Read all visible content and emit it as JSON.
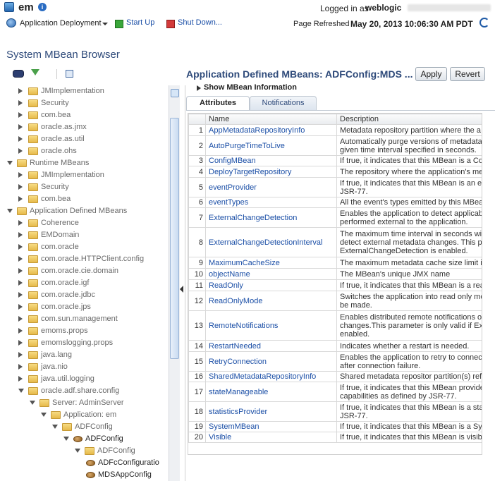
{
  "header": {
    "app_name": "em",
    "logged_in_label": "Logged in as",
    "user": "weblogic",
    "nav_menu": "Application Deployment",
    "start_up": "Start Up",
    "shut_down": "Shut Down...",
    "refresh_label": "Page Refreshed",
    "refresh_time": "May 20, 2013 10:06:30 AM PDT"
  },
  "sidebar": {
    "title": "System MBean Browser",
    "tree": [
      {
        "label": "JMImplementation",
        "icon": "folder",
        "expander": "collapsed"
      },
      {
        "label": "Security",
        "icon": "folder",
        "expander": "collapsed"
      },
      {
        "label": "com.bea",
        "icon": "folder",
        "expander": "collapsed"
      },
      {
        "label": "oracle.as.jmx",
        "icon": "folder",
        "expander": "collapsed"
      },
      {
        "label": "oracle.as.util",
        "icon": "folder",
        "expander": "collapsed"
      },
      {
        "label": "oracle.ohs",
        "icon": "folder",
        "expander": "collapsed"
      },
      {
        "label": "Runtime MBeans",
        "icon": "folder",
        "expander": "expanded"
      },
      {
        "label": "JMImplementation",
        "icon": "folder",
        "expander": "collapsed"
      },
      {
        "label": "Security",
        "icon": "folder",
        "expander": "collapsed"
      },
      {
        "label": "com.bea",
        "icon": "folder",
        "expander": "collapsed"
      },
      {
        "label": "Application Defined MBeans",
        "icon": "folder",
        "expander": "expanded"
      },
      {
        "label": "Coherence",
        "icon": "folder",
        "expander": "collapsed"
      },
      {
        "label": "EMDomain",
        "icon": "folder",
        "expander": "collapsed"
      },
      {
        "label": "com.oracle",
        "icon": "folder",
        "expander": "collapsed"
      },
      {
        "label": "com.oracle.HTTPClient.config",
        "icon": "folder",
        "expander": "collapsed"
      },
      {
        "label": "com.oracle.cie.domain",
        "icon": "folder",
        "expander": "collapsed"
      },
      {
        "label": "com.oracle.igf",
        "icon": "folder",
        "expander": "collapsed"
      },
      {
        "label": "com.oracle.jdbc",
        "icon": "folder",
        "expander": "collapsed"
      },
      {
        "label": "com.oracle.jps",
        "icon": "folder",
        "expander": "collapsed"
      },
      {
        "label": "com.sun.management",
        "icon": "folder",
        "expander": "collapsed"
      },
      {
        "label": "emoms.props",
        "icon": "folder",
        "expander": "collapsed"
      },
      {
        "label": "emomslogging.props",
        "icon": "folder",
        "expander": "collapsed"
      },
      {
        "label": "java.lang",
        "icon": "folder",
        "expander": "collapsed"
      },
      {
        "label": "java.nio",
        "icon": "folder",
        "expander": "collapsed"
      },
      {
        "label": "java.util.logging",
        "icon": "folder",
        "expander": "collapsed"
      },
      {
        "label": "oracle.adf.share.config",
        "icon": "folder",
        "expander": "expanded"
      },
      {
        "label": "Server: AdminServer",
        "icon": "folder",
        "expander": "expanded"
      },
      {
        "label": "Application: em",
        "icon": "folder",
        "expander": "expanded"
      },
      {
        "label": "ADFConfig",
        "icon": "folder",
        "expander": "expanded"
      },
      {
        "label": "ADFConfig",
        "icon": "bean",
        "expander": "expanded"
      },
      {
        "label": "ADFConfig",
        "icon": "folder",
        "expander": "expanded"
      },
      {
        "label": "ADFcConfiguratio",
        "icon": "bean",
        "expander": "none"
      },
      {
        "label": "MDSAppConfig",
        "icon": "bean",
        "expander": "none"
      }
    ]
  },
  "main": {
    "title": "Application Defined MBeans: ADFConfig:MDS ...",
    "apply": "Apply",
    "revert": "Revert",
    "show_info": "Show MBean Information",
    "tabs": [
      "Attributes",
      "Notifications"
    ],
    "columns": [
      "Name",
      "Description"
    ],
    "rows": [
      {
        "n": "1",
        "name": "AppMetadataRepositoryInfo",
        "desc": "Metadata repository partition where the a"
      },
      {
        "n": "2",
        "name": "AutoPurgeTimeToLive",
        "desc": "Automatically purge versions of metadata given time interval specified in seconds."
      },
      {
        "n": "3",
        "name": "ConfigMBean",
        "desc": "If true, it indicates that this MBean is a Co"
      },
      {
        "n": "4",
        "name": "DeployTargetRepository",
        "desc": "The repository where the application's met"
      },
      {
        "n": "5",
        "name": "eventProvider",
        "desc": "If true, it indicates that this MBean is an e JSR-77."
      },
      {
        "n": "6",
        "name": "eventTypes",
        "desc": "All the event's types emitted by this MBea"
      },
      {
        "n": "7",
        "name": "ExternalChangeDetection",
        "desc": "Enables the application to detect applicabl performed external to the application."
      },
      {
        "n": "8",
        "name": "ExternalChangeDetectionInterval",
        "desc": "The maximum time interval in seconds with detect external metadata changes. This p ExternalChangeDetection is enabled."
      },
      {
        "n": "9",
        "name": "MaximumCacheSize",
        "desc": "The maximum metadata cache size limit in"
      },
      {
        "n": "10",
        "name": "objectName",
        "desc": "The MBean's unique JMX name"
      },
      {
        "n": "11",
        "name": "ReadOnly",
        "desc": "If true, it indicates that this MBean is a rea"
      },
      {
        "n": "12",
        "name": "ReadOnlyMode",
        "desc": "Switches the application into read only mo will be made."
      },
      {
        "n": "13",
        "name": "RemoteNotifications",
        "desc": "Enables distributed remote notifications of changes.This parameter is only valid if Ext enabled."
      },
      {
        "n": "14",
        "name": "RestartNeeded",
        "desc": "Indicates whether a restart is needed."
      },
      {
        "n": "15",
        "name": "RetryConnection",
        "desc": "Enables the application to retry to connect after connection failure."
      },
      {
        "n": "16",
        "name": "SharedMetadataRepositoryInfo",
        "desc": "Shared metadata repositor partition(s) ref"
      },
      {
        "n": "17",
        "name": "stateManageable",
        "desc": "If true, it indicates that this MBean provide capabilities as defined by JSR-77."
      },
      {
        "n": "18",
        "name": "statisticsProvider",
        "desc": "If true, it indicates that this MBean is a sta JSR-77."
      },
      {
        "n": "19",
        "name": "SystemMBean",
        "desc": "If true, it indicates that this MBean is a Sy"
      },
      {
        "n": "20",
        "name": "Visible",
        "desc": "If true, it indicates that this MBean is visib"
      }
    ]
  }
}
